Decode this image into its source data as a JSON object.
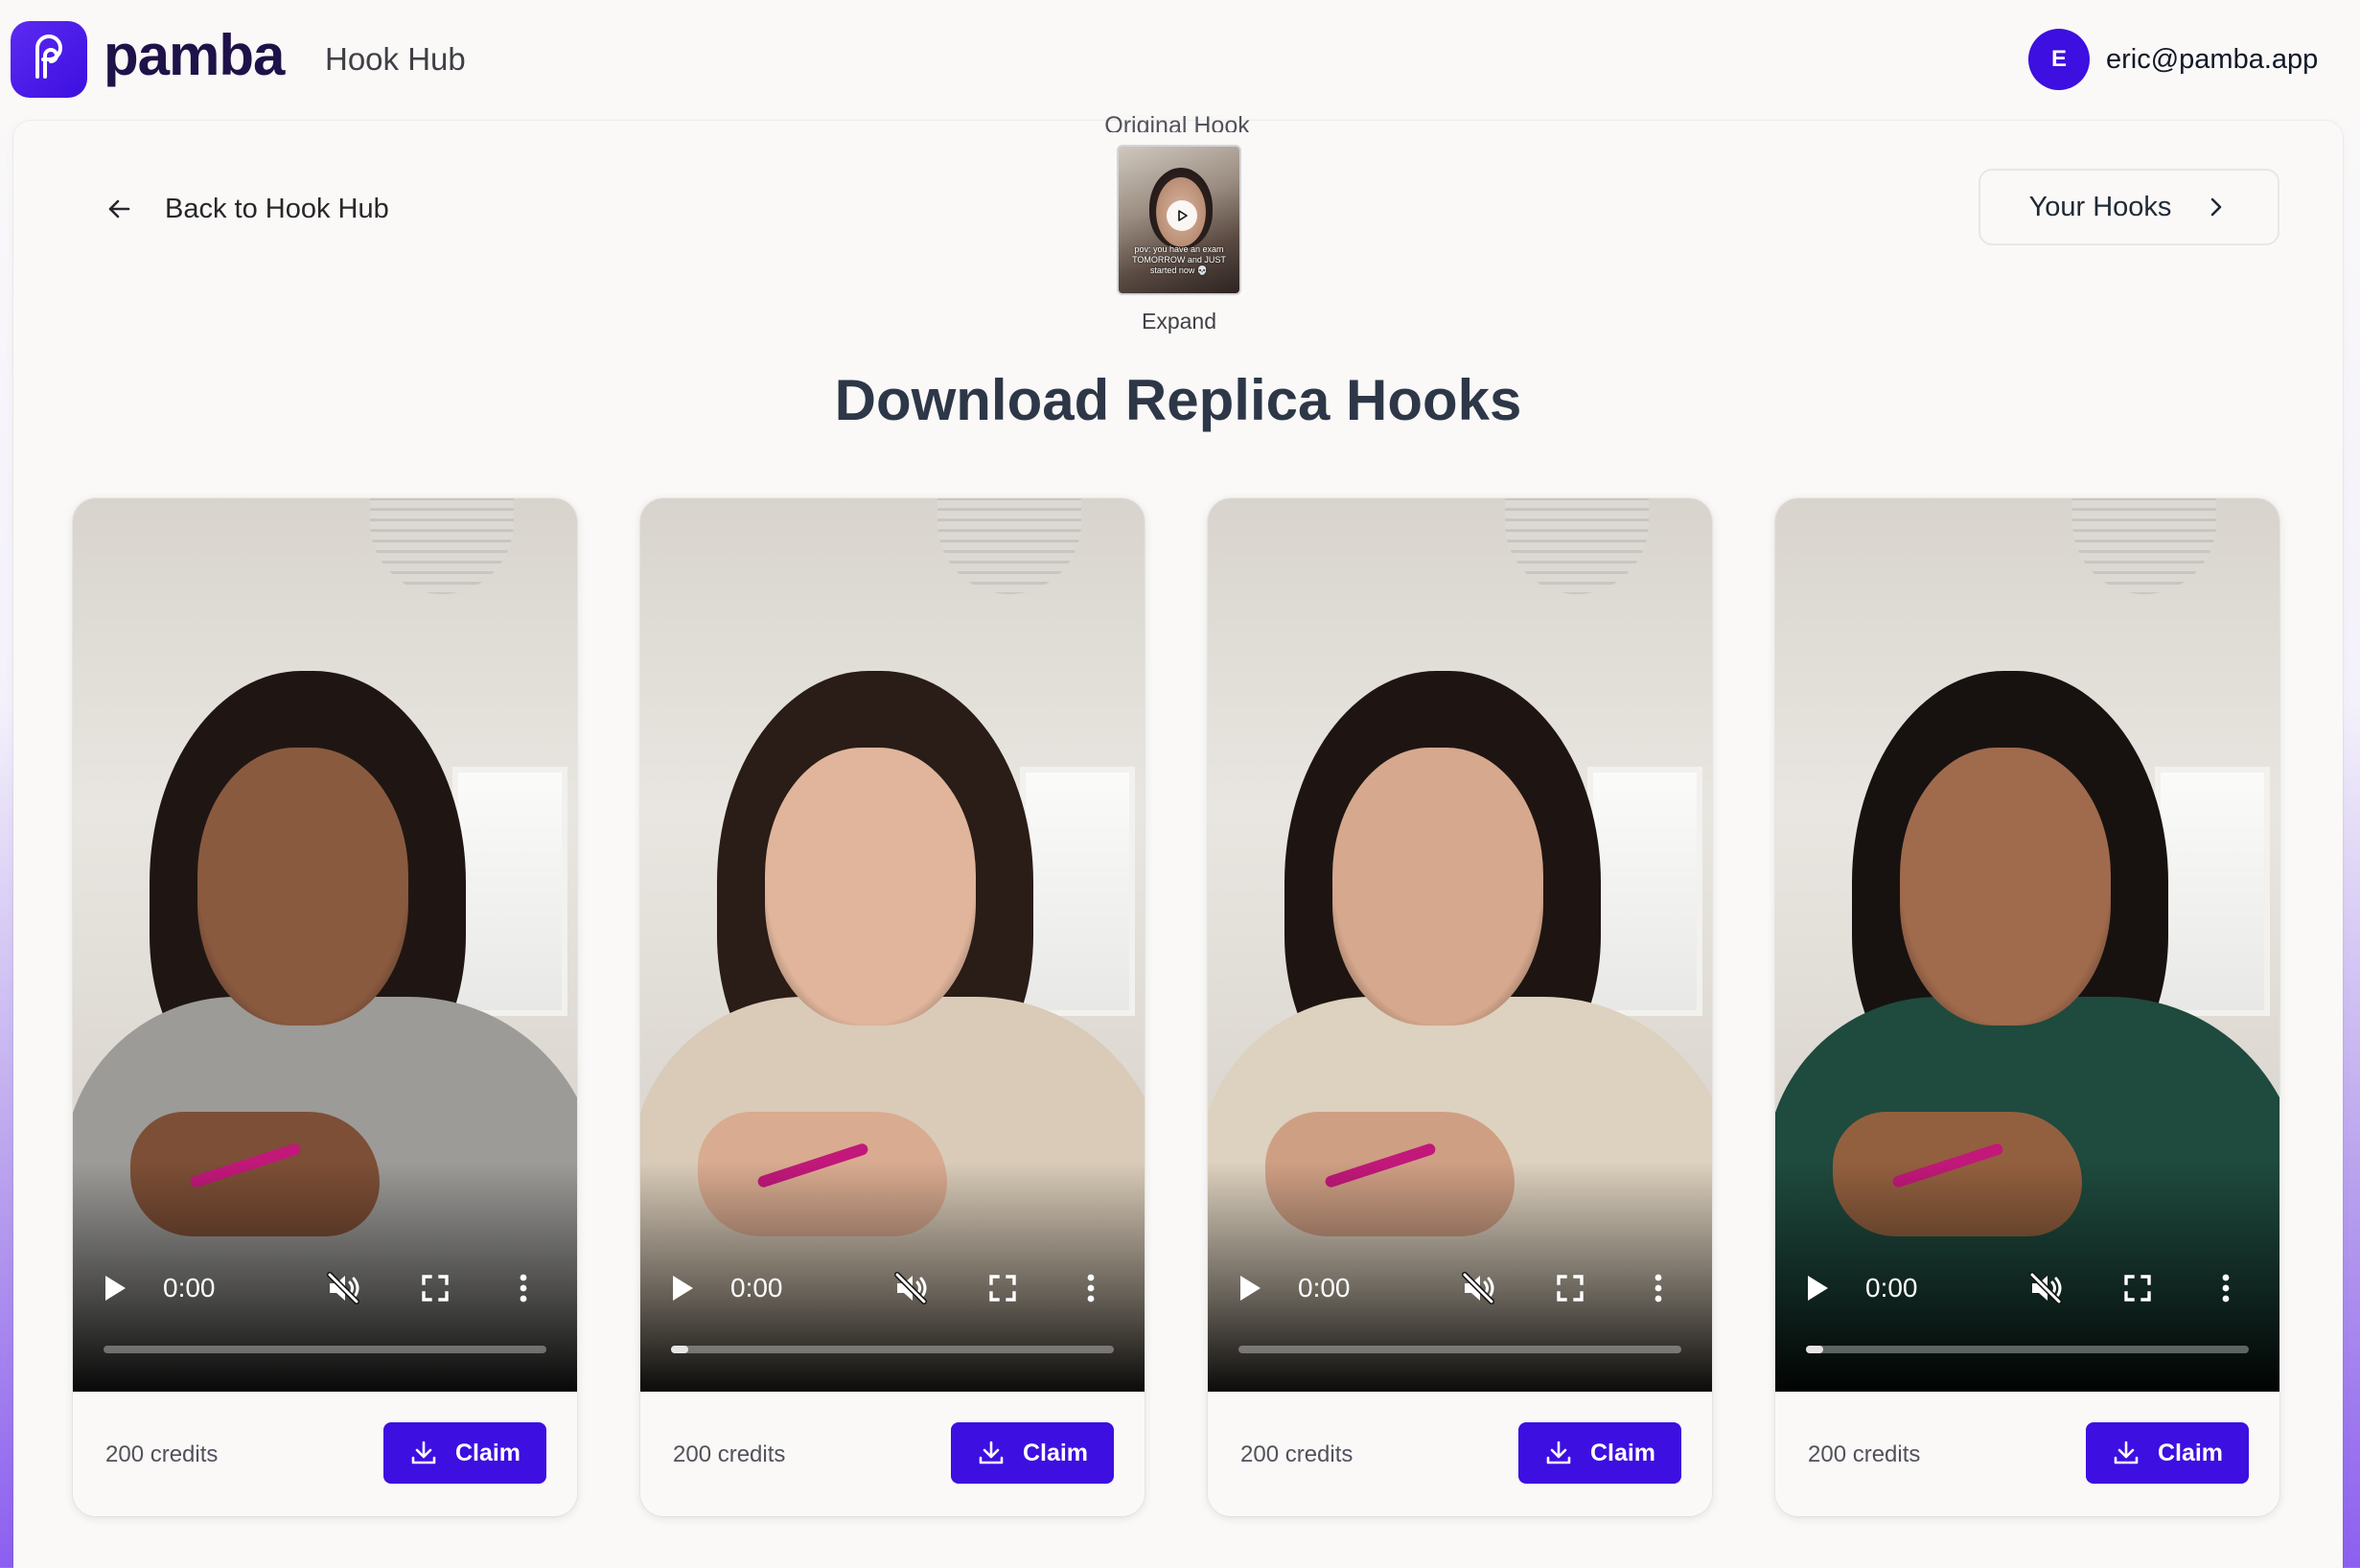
{
  "colors": {
    "accent": "#3d0fe0",
    "title": "#2d3748",
    "background": "#faf9f7"
  },
  "header": {
    "brand": "pamba",
    "logo_icon": "pamba-logo-icon",
    "nav_item": "Hook Hub",
    "avatar_initial": "E",
    "user_email": "eric@pamba.app"
  },
  "toolbar": {
    "back_label": "Back to Hook Hub",
    "back_icon": "arrow-left-icon",
    "your_hooks_label": "Your Hooks",
    "your_hooks_icon": "chevron-right-icon"
  },
  "original_hook": {
    "label": "Original Hook",
    "caption": "pov: you have an exam TOMORROW and JUST started now 💀",
    "expand_label": "Expand"
  },
  "page_title": "Download Replica Hooks",
  "hooks": [
    {
      "time": "0:00",
      "progress": 0.0,
      "credits": "200 credits",
      "claim_label": "Claim",
      "palette": {
        "hair": "#1f1613",
        "skin": "#8a5a3f",
        "top": "#9c9b98",
        "hand": "#7d4f36"
      }
    },
    {
      "time": "0:00",
      "progress": 0.04,
      "credits": "200 credits",
      "claim_label": "Claim",
      "palette": {
        "hair": "#2a1c16",
        "skin": "#e0b59c",
        "top": "#d9cbb8",
        "hand": "#d9ab90"
      }
    },
    {
      "time": "0:00",
      "progress": 0.0,
      "credits": "200 credits",
      "claim_label": "Claim",
      "palette": {
        "hair": "#1e1512",
        "skin": "#d6a88d",
        "top": "#ddd1bf",
        "hand": "#cf9f84"
      }
    },
    {
      "time": "0:00",
      "progress": 0.04,
      "credits": "200 credits",
      "claim_label": "Claim",
      "palette": {
        "hair": "#171210",
        "skin": "#a06a4c",
        "top": "#1f4a3e",
        "hand": "#93603f"
      }
    }
  ],
  "icons": {
    "play": "play-icon",
    "mute": "volume-mute-icon",
    "fullscreen": "fullscreen-icon",
    "more": "more-vertical-icon",
    "download": "download-icon"
  }
}
